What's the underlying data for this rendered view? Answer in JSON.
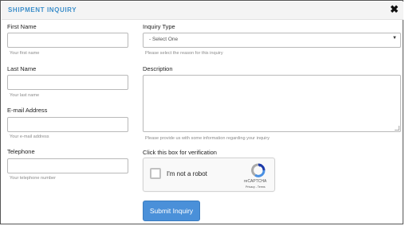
{
  "header": {
    "title": "SHIPMENT INQUIRY",
    "close_glyph": "✖",
    "close_icon": "close-icon"
  },
  "fields": {
    "first_name": {
      "label": "First Name",
      "value": "",
      "hint": "Your first name"
    },
    "last_name": {
      "label": "Last Name",
      "value": "",
      "hint": "Your last name"
    },
    "email": {
      "label": "E-mail Address",
      "value": "",
      "hint": "Your e-mail address"
    },
    "telephone": {
      "label": "Telephone",
      "value": "",
      "hint": "Your telephone number"
    },
    "inquiry_type": {
      "label": "Inquiry Type",
      "selected": "- Select One",
      "hint": "Please select the reason for this inquiry"
    },
    "description": {
      "label": "Description",
      "value": "",
      "hint": "Please provide us with some information regarding your inquiry"
    }
  },
  "verification": {
    "label": "Click this box for verification",
    "checkbox_text": "I'm not a robot",
    "brand": "reCAPTCHA",
    "terms": "Privacy - Terms",
    "logo_icon": "recaptcha-icon"
  },
  "submit": {
    "label": "Submit Inquiry"
  },
  "colors": {
    "accent": "#3d8fca",
    "button": "#4a90d9",
    "border": "#b9b9b9",
    "header_bg": "#f4f4f4"
  }
}
